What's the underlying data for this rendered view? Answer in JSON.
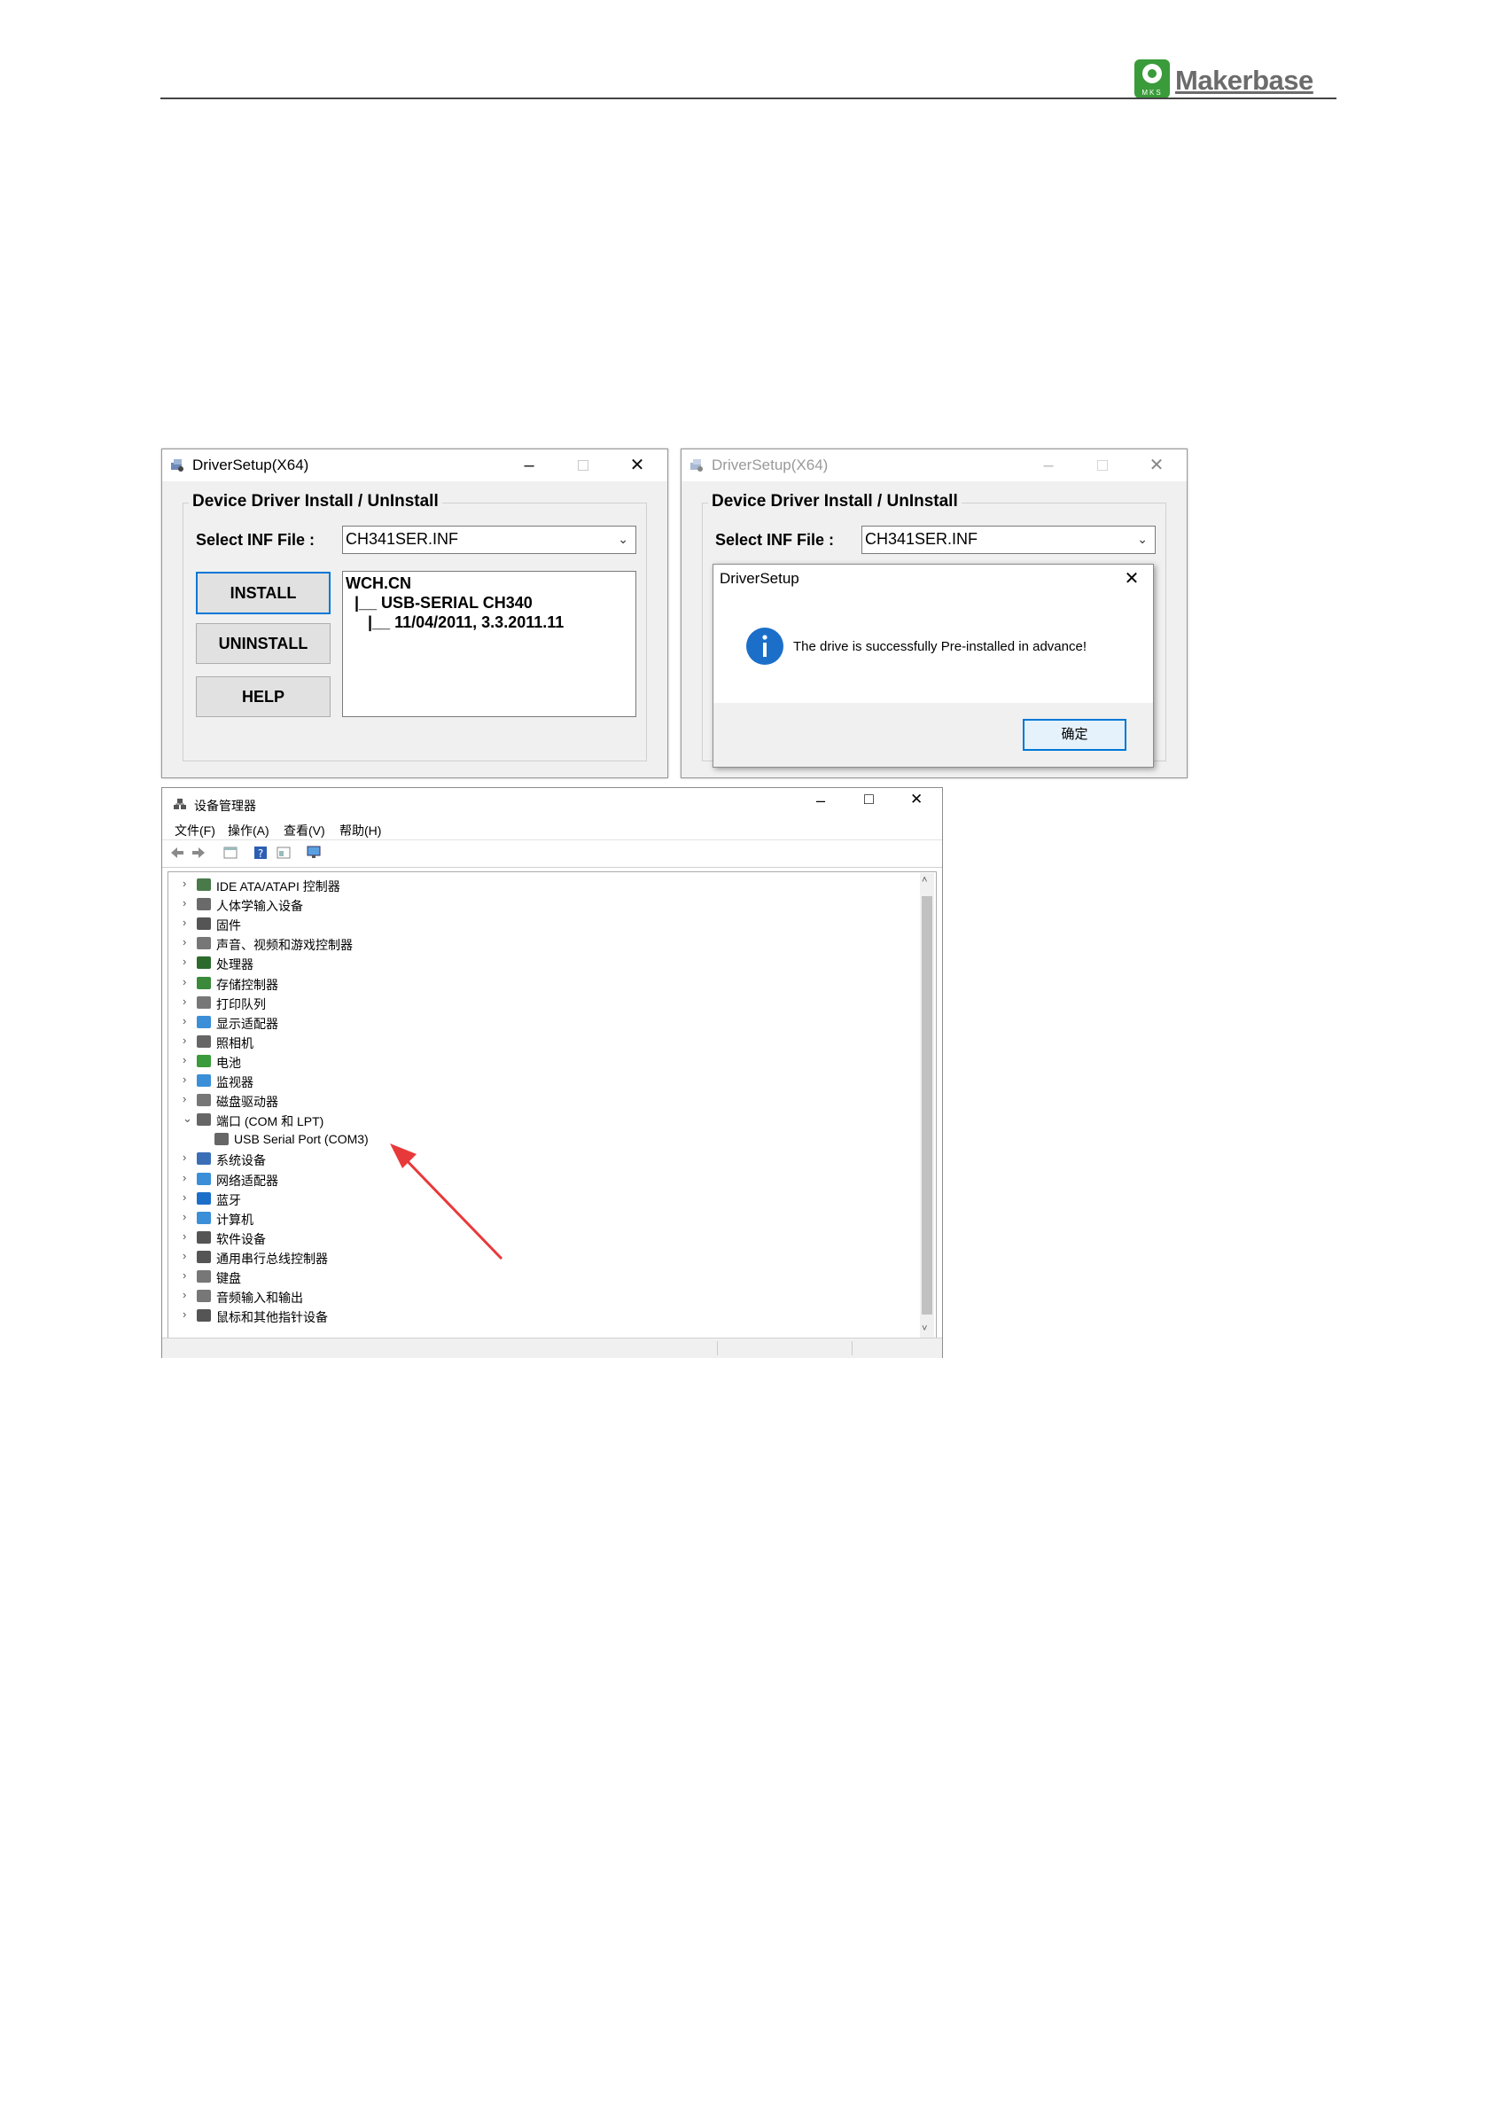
{
  "header": {
    "logo_text": "Makerbase",
    "logo_mark_text": "MKS"
  },
  "dialog_left": {
    "title": "DriverSetup(X64)",
    "group_title": "Device Driver Install / UnInstall",
    "select_label": "Select INF File :",
    "inf_value": "CH341SER.INF",
    "install_label": "INSTALL",
    "uninstall_label": "UNINSTALL",
    "help_label": "HELP",
    "info_lines": [
      "WCH.CN",
      "  |__ USB-SERIAL CH340",
      "     |__ 11/04/2011, 3.3.2011.11"
    ]
  },
  "dialog_right": {
    "title": "DriverSetup(X64)",
    "group_title": "Device Driver Install / UnInstall",
    "select_label": "Select INF File :",
    "inf_value": "CH341SER.INF"
  },
  "message_box": {
    "title": "DriverSetup",
    "message": "The drive is successfully Pre-installed in advance!",
    "ok_label": "确定"
  },
  "device_manager": {
    "title": "设备管理器",
    "menus": [
      "文件(F)",
      "操作(A)",
      "查看(V)",
      "帮助(H)"
    ],
    "tree": [
      {
        "label": "IDE ATA/ATAPI 控制器",
        "icon": "ide-icon",
        "expanded": false
      },
      {
        "label": "人体学输入设备",
        "icon": "hid-icon",
        "expanded": false
      },
      {
        "label": "固件",
        "icon": "firmware-icon",
        "expanded": false
      },
      {
        "label": "声音、视频和游戏控制器",
        "icon": "sound-icon",
        "expanded": false
      },
      {
        "label": "处理器",
        "icon": "cpu-icon",
        "expanded": false
      },
      {
        "label": "存储控制器",
        "icon": "storage-icon",
        "expanded": false
      },
      {
        "label": "打印队列",
        "icon": "printer-icon",
        "expanded": false
      },
      {
        "label": "显示适配器",
        "icon": "display-icon",
        "expanded": false
      },
      {
        "label": "照相机",
        "icon": "camera-icon",
        "expanded": false
      },
      {
        "label": "电池",
        "icon": "battery-icon",
        "expanded": false
      },
      {
        "label": "监视器",
        "icon": "monitor-icon",
        "expanded": false
      },
      {
        "label": "磁盘驱动器",
        "icon": "disk-icon",
        "expanded": false
      },
      {
        "label": "端口 (COM 和 LPT)",
        "icon": "port-icon",
        "expanded": true
      },
      {
        "label": "USB Serial Port (COM3)",
        "icon": "port-icon",
        "child": true
      },
      {
        "label": "系统设备",
        "icon": "system-icon",
        "expanded": false
      },
      {
        "label": "网络适配器",
        "icon": "network-icon",
        "expanded": false
      },
      {
        "label": "蓝牙",
        "icon": "bluetooth-icon",
        "expanded": false
      },
      {
        "label": "计算机",
        "icon": "computer-icon",
        "expanded": false
      },
      {
        "label": "软件设备",
        "icon": "software-icon",
        "expanded": false
      },
      {
        "label": "通用串行总线控制器",
        "icon": "usb-icon",
        "expanded": false
      },
      {
        "label": "键盘",
        "icon": "keyboard-icon",
        "expanded": false
      },
      {
        "label": "音频输入和输出",
        "icon": "audio-icon",
        "expanded": false
      },
      {
        "label": "鼠标和其他指针设备",
        "icon": "mouse-icon",
        "expanded": false
      }
    ]
  },
  "colors": {
    "accent": "#0078d7",
    "arrow": "#e8393a",
    "logo_green": "#3a9b3a"
  }
}
